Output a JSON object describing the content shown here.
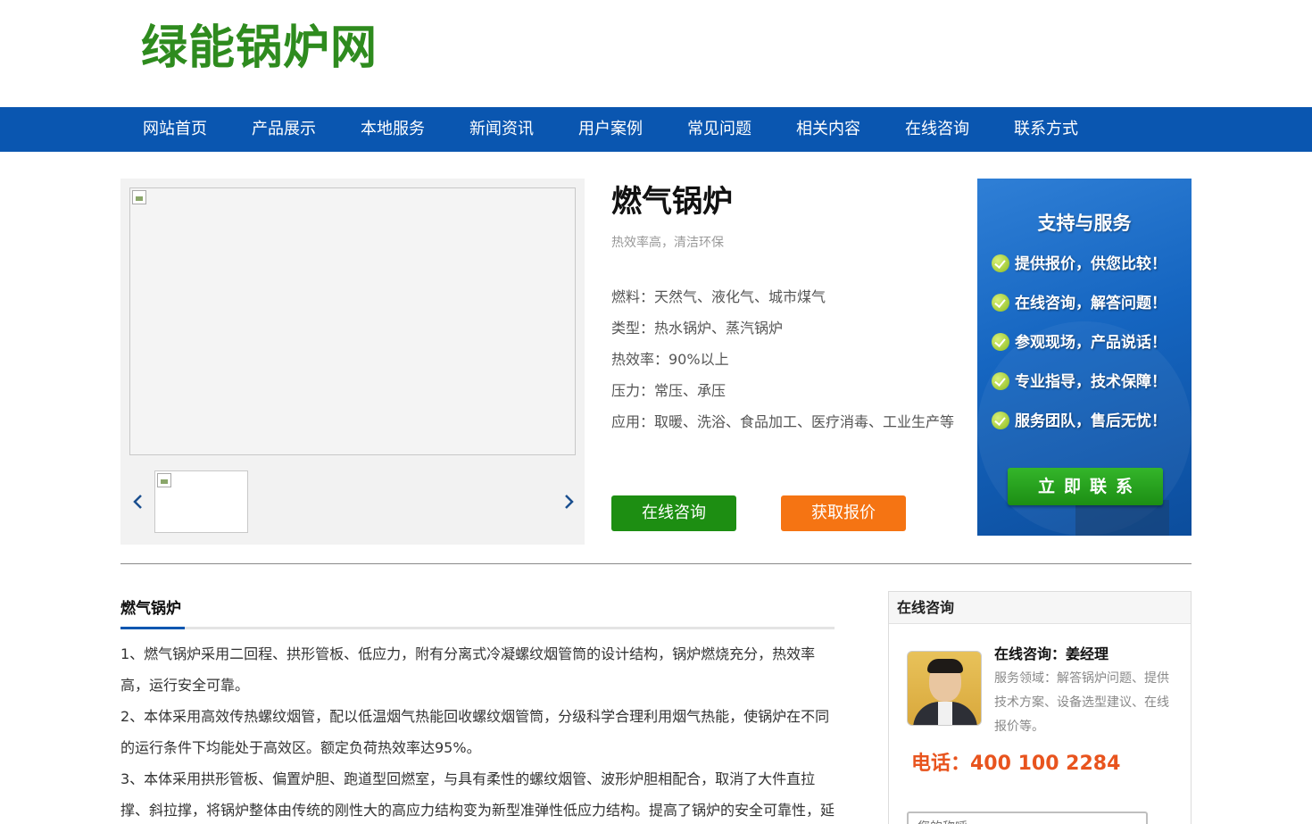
{
  "site": {
    "logo": "绿能锅炉网"
  },
  "nav": {
    "items": [
      "网站首页",
      "产品展示",
      "本地服务",
      "新闻资讯",
      "用户案例",
      "常见问题",
      "相关内容",
      "在线咨询",
      "联系方式"
    ]
  },
  "product": {
    "title": "燃气锅炉",
    "subtitle": "热效率高，清洁环保",
    "specs": [
      "燃料：天然气、液化气、城市煤气",
      "类型：热水锅炉、蒸汽锅炉",
      "热效率：90%以上",
      "压力：常压、承压",
      "应用：取暖、洗浴、食品加工、医疗消毒、工业生产等"
    ],
    "buttons": {
      "consult": "在线咨询",
      "quote": "获取报价"
    }
  },
  "support": {
    "title": "支持与服务",
    "items": [
      "提供报价，供您比较！",
      "在线咨询，解答问题！",
      "参观现场，产品说话！",
      "专业指导，技术保障！",
      "服务团队，售后无忧！"
    ],
    "cta": "立即联系"
  },
  "description": {
    "title": "燃气锅炉",
    "paragraphs": [
      "1、燃气锅炉采用二回程、拱形管板、低应力，附有分离式冷凝螺纹烟管筒的设计结构，锅炉燃烧充分，热效率高，运行安全可靠。",
      "2、本体采用高效传热螺纹烟管，配以低温烟气热能回收螺纹烟管筒，分级科学合理利用烟气热能，使锅炉在不同的运行条件下均能处于高效区。额定负荷热效率达95%。",
      "3、本体采用拱形管板、偏置炉胆、跑道型回燃室，与具有柔性的螺纹烟管、波形炉胆相配合，取消了大件直拉撑、斜拉撑，将锅炉整体由传统的刚性大的高应力结构变为新型准弹性低应力结构。提高了锅炉的安全可靠性，延"
    ]
  },
  "consult": {
    "header": "在线咨询",
    "name": "在线咨询：姜经理",
    "desc": "服务领域：解答锅炉问题、提供技术方案、设备选型建议、在线报价等。",
    "phone": "电话：400 100 2284",
    "input_placeholder": "您的称呼"
  }
}
